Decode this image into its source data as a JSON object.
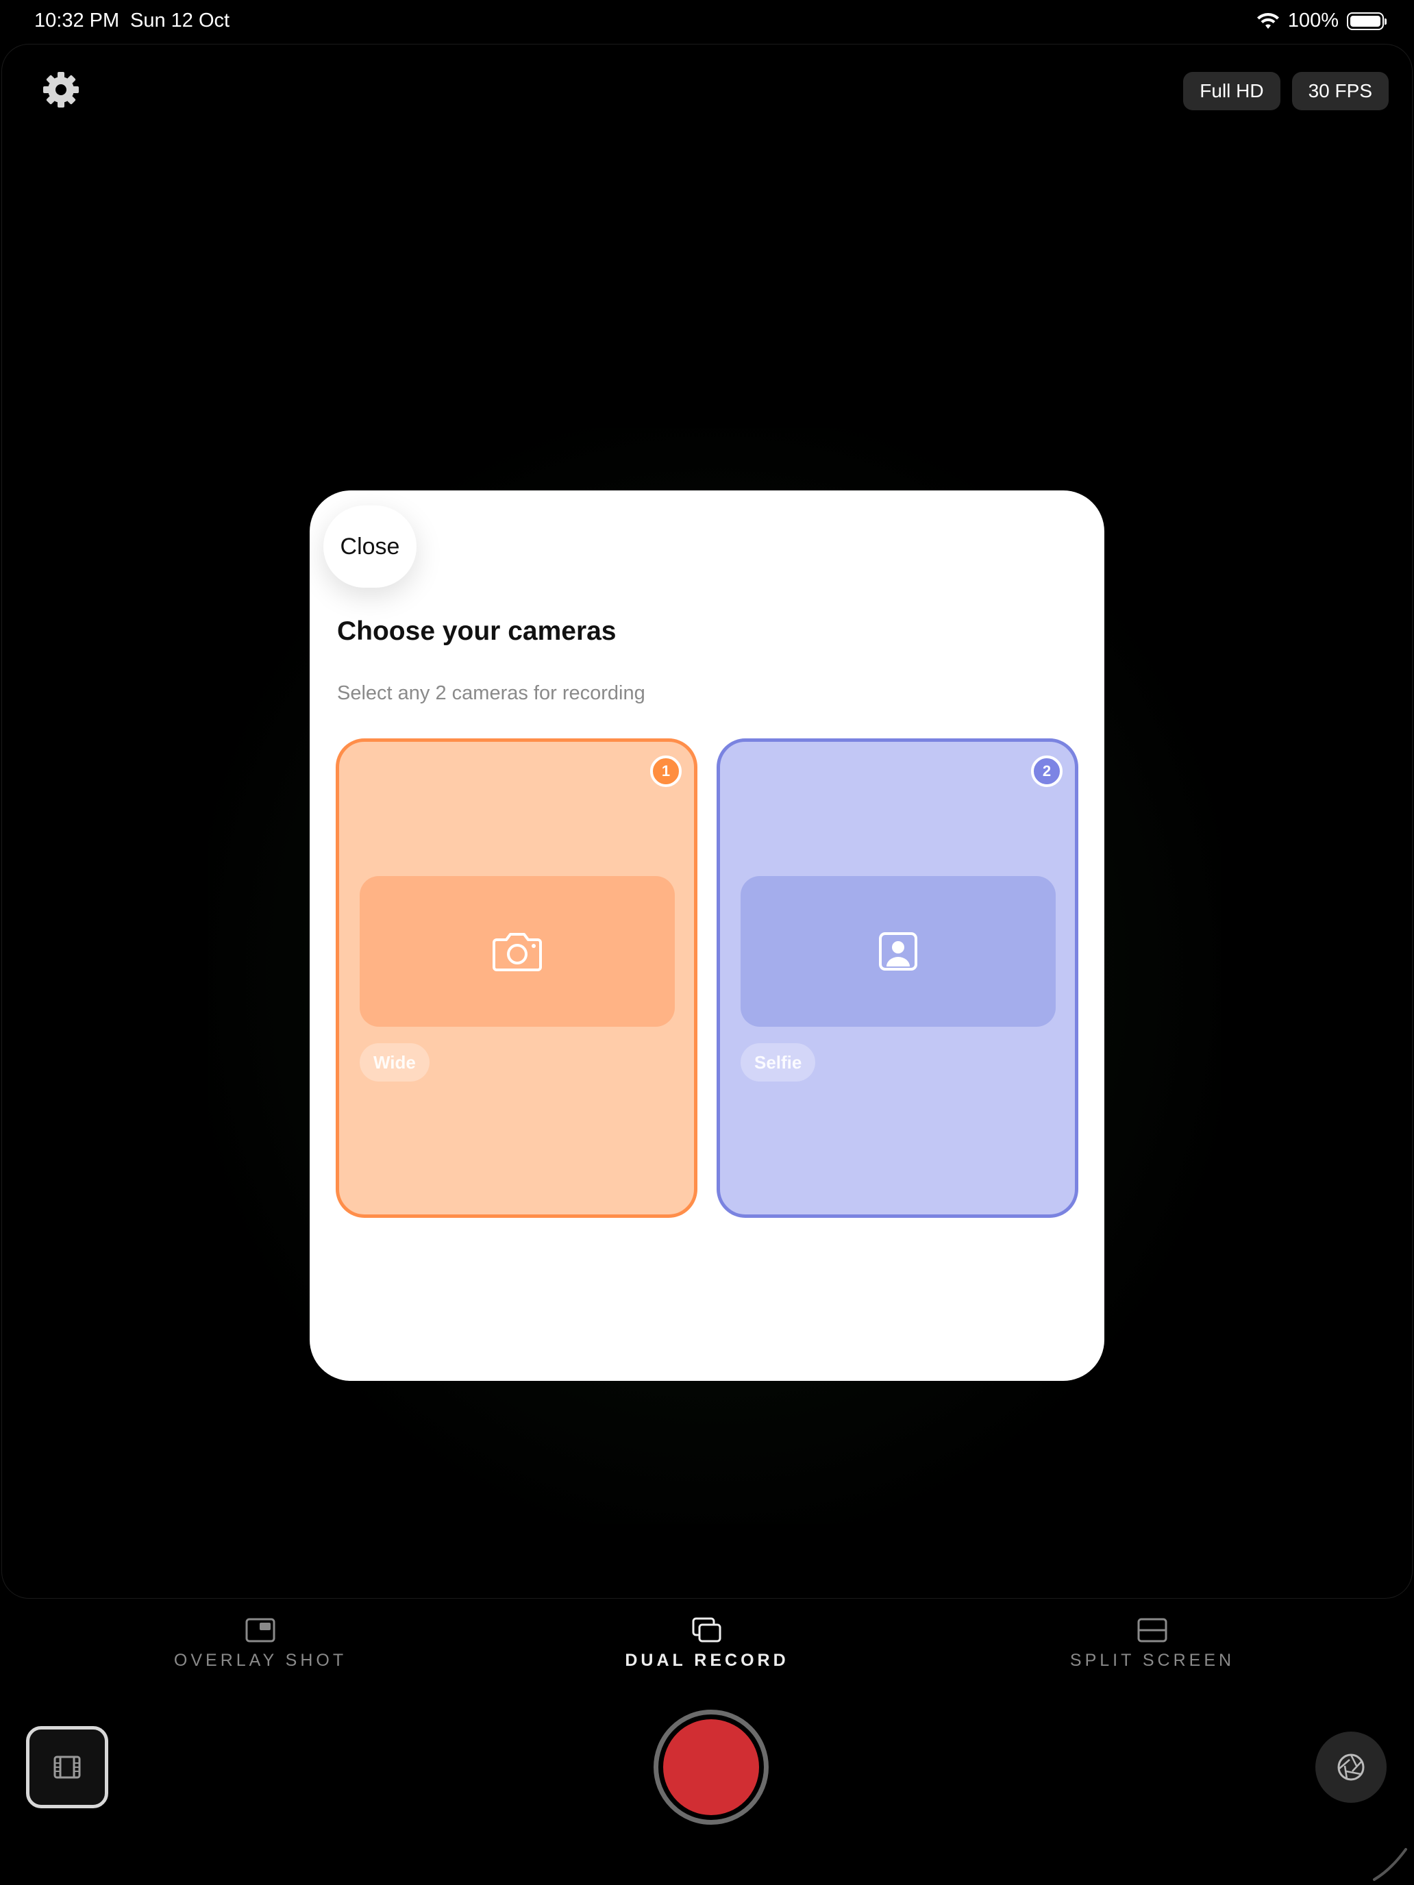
{
  "status_bar": {
    "time": "10:32 PM",
    "date": "Sun 12 Oct",
    "battery": "100%"
  },
  "top_bar": {
    "settings_icon": "gear-icon",
    "resolution_chip": "Full HD",
    "fps_chip": "30 FPS"
  },
  "modal": {
    "close_label": "Close",
    "title": "Choose your cameras",
    "subtitle": "Select any 2 cameras for recording",
    "cameras": [
      {
        "label": "Wide",
        "badge": "1",
        "icon": "camera-icon",
        "accent": "#ff8e4a"
      },
      {
        "label": "Selfie",
        "badge": "2",
        "icon": "portrait-icon",
        "accent": "#7a83e0"
      }
    ]
  },
  "modes": {
    "items": [
      {
        "label": "OVERLAY SHOT",
        "icon": "overlay-shot-icon",
        "active": false
      },
      {
        "label": "DUAL RECORD",
        "icon": "dual-record-icon",
        "active": true
      },
      {
        "label": "SPLIT SCREEN",
        "icon": "split-screen-icon",
        "active": false
      }
    ]
  },
  "controls": {
    "gallery_icon": "film-icon",
    "record_color": "#d12e33",
    "flip_icon": "aperture-icon"
  }
}
